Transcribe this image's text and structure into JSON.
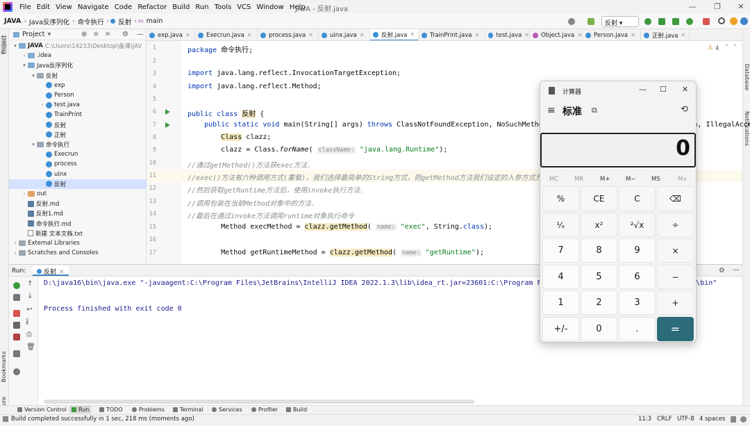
{
  "ide": {
    "window_title": "JAVA - 反射.java",
    "menu": [
      "File",
      "Edit",
      "View",
      "Navigate",
      "Code",
      "Refactor",
      "Build",
      "Run",
      "Tools",
      "VCS",
      "Window",
      "Help"
    ],
    "breadcrumbs": [
      "JAVA",
      "Java反序列化",
      "命令执行",
      "反射",
      "main"
    ],
    "run_config": "反射",
    "warnings": "4"
  },
  "project": {
    "header": "Project",
    "tree": [
      {
        "label": "JAVA",
        "extra": "C:\\Users\\14233\\Desktop\\备课\\JAV",
        "kind": "folder",
        "level": 0,
        "arrow": "▾"
      },
      {
        "label": ".idea",
        "kind": "folder",
        "level": 1,
        "arrow": "›"
      },
      {
        "label": "Java反序列化",
        "kind": "folder",
        "level": 1,
        "arrow": "▾"
      },
      {
        "label": "反射",
        "kind": "pkg",
        "level": 2,
        "arrow": "▾"
      },
      {
        "label": "exp",
        "kind": "class",
        "level": 3,
        "arrow": ""
      },
      {
        "label": "Person",
        "kind": "class",
        "level": 3,
        "arrow": ""
      },
      {
        "label": "test.java",
        "kind": "class",
        "level": 3,
        "arrow": "›"
      },
      {
        "label": "TrainPrint",
        "kind": "class",
        "level": 3,
        "arrow": ""
      },
      {
        "label": "反射",
        "kind": "class",
        "level": 3,
        "arrow": ""
      },
      {
        "label": "正射",
        "kind": "class",
        "level": 3,
        "arrow": ""
      },
      {
        "label": "命令执行",
        "kind": "pkg",
        "level": 2,
        "arrow": "▾"
      },
      {
        "label": "Execrun",
        "kind": "class",
        "level": 3,
        "arrow": ""
      },
      {
        "label": "process",
        "kind": "class",
        "level": 3,
        "arrow": ""
      },
      {
        "label": "uinx",
        "kind": "class",
        "level": 3,
        "arrow": ""
      },
      {
        "label": "反射",
        "kind": "class",
        "level": 3,
        "arrow": "",
        "selected": true
      },
      {
        "label": "out",
        "kind": "orange",
        "level": 1,
        "arrow": "›"
      },
      {
        "label": "反射.md",
        "kind": "md",
        "level": 1,
        "arrow": ""
      },
      {
        "label": "反射1.md",
        "kind": "md",
        "level": 1,
        "arrow": ""
      },
      {
        "label": "命令执行.md",
        "kind": "md",
        "level": 1,
        "arrow": ""
      },
      {
        "label": "新建 文本文档.txt",
        "kind": "txt",
        "level": 1,
        "arrow": ""
      },
      {
        "label": "External Libraries",
        "kind": "pkg",
        "level": 0,
        "arrow": "›"
      },
      {
        "label": "Scratches and Consoles",
        "kind": "pkg",
        "level": 0,
        "arrow": "›"
      }
    ]
  },
  "tabs": [
    {
      "label": "exp.java",
      "active": false
    },
    {
      "label": "Execrun.java",
      "active": false
    },
    {
      "label": "process.java",
      "active": false
    },
    {
      "label": "uinx.java",
      "active": false
    },
    {
      "label": "反射.java",
      "active": true
    },
    {
      "label": "TrainPrint.java",
      "active": false
    },
    {
      "label": "test.java",
      "active": false
    },
    {
      "label": "Object.java",
      "active": false
    },
    {
      "label": "Person.java",
      "active": false
    },
    {
      "label": "正射.java",
      "active": false
    }
  ],
  "code": {
    "lines": [
      "1",
      "2",
      "3",
      "4",
      "5",
      "6",
      "7",
      "8",
      "9",
      "10",
      "11",
      "12",
      "13",
      "14",
      "15",
      "16",
      "17"
    ],
    "l1_kw": "package",
    "l1_rest": " 命令执行;",
    "l3_kw": "import",
    "l3_rest": " java.lang.reflect.InvocationTargetException;",
    "l4_kw": "import",
    "l4_rest": " java.lang.reflect.Method;",
    "l6_kw": "public class",
    "l6_name": "反射",
    "l6_rest": " {",
    "l7_kw": "    public static void",
    "l7_mid": " main(String[] args) ",
    "l7_kw2": "throws",
    "l7_rest": " ClassNotFoundException, NoSuchMethodException, InvocationTargetException, IllegalAccessException {",
    "l8_cls": "Class",
    "l8_rest": " clazz;",
    "l9_a": "        clazz = Class.",
    "l9_m": "forName",
    "l9_b": "( ",
    "l9_hint": "className:",
    "l9_str": " \"java.lang.Runtime\"",
    "l9_c": ");",
    "l10": "//通过getMethod()方法获exec方法.",
    "l11": "//exec()方法有六种调用方式(重载)，我们选择最简单的String方式，则getMethod方法我们设定的入参方式为String.class",
    "l12": "//然后获取getRuntime方法后，使用invoke执行方法.",
    "l13": "//调用包装在当前Method对象中的方法.",
    "l14": "//最后在通过invoke方法调用runtime对象执行命令",
    "l15_a": "        Method execMethod = ",
    "l15_m": "clazz.getMethod",
    "l15_b": "( ",
    "l15_hint": "name:",
    "l15_str": " \"exec\"",
    "l15_c": ", String.",
    "l15_kw": "class",
    "l15_d": ");",
    "l17_a": "        Method getRuntimeMethod = ",
    "l17_m": "clazz.getMethod",
    "l17_b": "( ",
    "l17_hint": "name:",
    "l17_str": " \"getRuntime\"",
    "l17_c": ");"
  },
  "run": {
    "label": "Run:",
    "tab": "反射",
    "cmd": "D:\\java16\\bin\\java.exe \"-javaagent:C:\\Program Files\\JetBrains\\IntelliJ IDEA 2022.1.3\\lib\\idea_rt.jar=23601:C:\\Program Files\\JetBrains\\IntelliJ IDEA 2022.1.3\\bin\"",
    "exit": "Process finished with exit code 0"
  },
  "bottom_tools": [
    "Version Control",
    "Run",
    "TODO",
    "Problems",
    "Terminal",
    "Services",
    "Profiler",
    "Build"
  ],
  "status": {
    "message": "Build completed successfully in 1 sec, 218 ms (moments ago)",
    "position": "11:3",
    "line_sep": "CRLF",
    "encoding": "UTF-8",
    "indent": "4 spaces"
  },
  "side_labels": {
    "project": "Project",
    "bookmarks": "Bookmarks",
    "structure": "Structure",
    "database": "Database",
    "notifications": "Notifications"
  },
  "calculator": {
    "title": "计算器",
    "mode": "标准",
    "display": "0",
    "memory": [
      "MC",
      "MR",
      "M+",
      "M−",
      "MS",
      "M∨"
    ],
    "buttons": [
      [
        "%",
        "CE",
        "C",
        "⌫"
      ],
      [
        "¹⁄ₓ",
        "x²",
        "²√x",
        "÷"
      ],
      [
        "7",
        "8",
        "9",
        "×"
      ],
      [
        "4",
        "5",
        "6",
        "−"
      ],
      [
        "1",
        "2",
        "3",
        "+"
      ],
      [
        "+/-",
        "0",
        ".",
        "="
      ]
    ],
    "accent": "#2c6b78"
  }
}
